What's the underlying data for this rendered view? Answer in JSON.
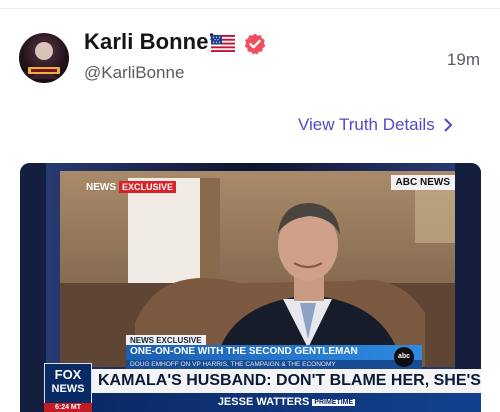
{
  "post": {
    "display_name": "Karli Bonne’",
    "handle": "@KarliBonne",
    "timestamp": "19m",
    "view_details_label": "View Truth Details",
    "flag_icon": "us-flag-icon",
    "verified_icon": "verified-badge-icon"
  },
  "media": {
    "abc_corner": "NEWS",
    "abc_exclusive": "EXCLUSIVE",
    "abc_network_tag": "ABC NEWS",
    "lower_third": {
      "exclusive": "NEWS EXCLUSIVE",
      "headline": "ONE-ON-ONE WITH THE SECOND GENTLEMAN",
      "subline": "DOUG EMHOFF ON VP HARRIS, THE CAMPAIGN & THE ECONOMY",
      "badge": "abc"
    },
    "fox_logo_line1": "FOX",
    "fox_logo_line2": "NEWS",
    "fox_time": "6:24 MT",
    "chyron": "KAMALA'S HUSBAND: DON'T BLAME HER, SHE'S THE VP",
    "chyron_sub": "JESSE WATTERS",
    "chyron_sub_tag": "PRIMETIME"
  },
  "colors": {
    "accent_link": "#5448c8",
    "verified": "#f04e5e",
    "fox_blue": "#0a2a66"
  }
}
